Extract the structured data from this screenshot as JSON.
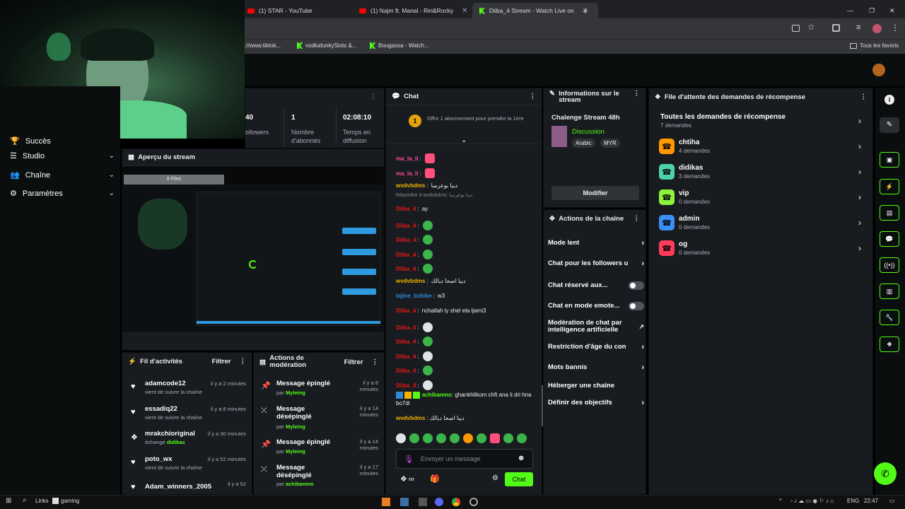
{
  "browser": {
    "tabs": [
      {
        "title": "(1) STAR - YouTube",
        "icon": "youtube-icon"
      },
      {
        "title": "(1) Najm ft. Manal - Riri&Rocky",
        "icon": "youtube-icon"
      },
      {
        "title": "Diiba_4 Stream - Watch Live on",
        "icon": "kick-icon"
      }
    ],
    "new_tab": "+",
    "window_controls": [
      "—",
      "❐",
      "✕"
    ],
    "bookmarks": [
      {
        "label": "://www.tiktok..."
      },
      {
        "label": "vodkafunkySlots &...",
        "icon": "kick-icon"
      },
      {
        "label": "Bougassa - Watch...",
        "icon": "kick-icon"
      }
    ],
    "all_bookmarks": "Tous les favoris"
  },
  "sidebar": {
    "items": [
      {
        "label": "Succès",
        "icon": "trophy-icon"
      },
      {
        "label": "Studio",
        "icon": "sliders-icon"
      },
      {
        "label": "Chaîne",
        "icon": "people-icon"
      },
      {
        "label": "Paramètres",
        "icon": "gear-icon"
      }
    ]
  },
  "stats": {
    "items": [
      {
        "value": "40",
        "label": "ollowers"
      },
      {
        "value": "1",
        "label": "Nombre d'abonnés"
      },
      {
        "value": "02:08:10",
        "label": "Temps en diffusion"
      }
    ]
  },
  "preview": {
    "title": "Aperçu du stream",
    "overlay_label": "9 Files"
  },
  "activity": {
    "title": "Fil d'activités",
    "filter": "Filtrer",
    "items": [
      {
        "user": "adamcode12",
        "time": "il y a 2 minutes",
        "detail": "vient de suivre la chaîne",
        "icon": "heart-icon"
      },
      {
        "user": "essadiq22",
        "time": "il y a 8 minutes",
        "detail": "vient de suivre la chaîne",
        "icon": "heart-icon"
      },
      {
        "user": "mrakchioriginal",
        "time": "il y a 30 minutes",
        "detail_prefix": "échangé",
        "detail_highlight": "didikas",
        "icon": "reward-icon"
      },
      {
        "user": "poto_wx",
        "time": "il y a 52 minutes",
        "detail": "vient de suivre la chaîne",
        "icon": "heart-icon"
      },
      {
        "user": "Adam_winners_2005",
        "time": "il y a 52",
        "detail": "",
        "icon": "heart-icon"
      }
    ]
  },
  "moderation": {
    "title": "Actions de modération",
    "filter": "Filtrer",
    "items": [
      {
        "action": "Message épinglé",
        "time": "il y a 8 minutes",
        "by": "par",
        "mod": "Myleing",
        "icon": "pin-icon"
      },
      {
        "action": "Message désépinglé",
        "time": "il y a 14 minutes",
        "by": "par",
        "mod": "Myleing",
        "icon": "unpin-icon"
      },
      {
        "action": "Message épinglé",
        "time": "il y a 14 minutes",
        "by": "par",
        "mod": "Myleing",
        "icon": "pin-icon"
      },
      {
        "action": "Message désépinglé",
        "time": "il y a 17 minutes",
        "by": "par",
        "mod": "achibanmo",
        "icon": "unpin-icon"
      }
    ]
  },
  "chat": {
    "title": "Chat",
    "sub_banner": {
      "count": "1",
      "text": "Offrir 1 abonnement pour prendre la 1ère"
    },
    "reply_to": "Répondre à wvdvbdms: ديبا بوعرسا",
    "messages": [
      {
        "user": "ma_la_li",
        "text": "",
        "color": "#ff4fa0",
        "emotes": 1,
        "emote_style": "heart"
      },
      {
        "user": "ma_la_li",
        "text": "",
        "color": "#ff4fa0",
        "emotes": 1,
        "emote_style": "heart"
      },
      {
        "user": "wvdvbdms",
        "text": "ديبا بوعرسا",
        "color": "#f0b400",
        "emotes": 0
      },
      {
        "user": "Diiba_4",
        "text": "ay",
        "color": "#e91916",
        "emotes": 0
      },
      {
        "user": "Diiba_4",
        "text": "",
        "color": "#e91916",
        "emotes": 1
      },
      {
        "user": "Diiba_4",
        "text": "",
        "color": "#e91916",
        "emotes": 1
      },
      {
        "user": "Diiba_4",
        "text": "",
        "color": "#e91916",
        "emotes": 1
      },
      {
        "user": "Diiba_4",
        "text": "",
        "color": "#e91916",
        "emotes": 1
      },
      {
        "user": "wvdvbdms",
        "text": "ديبا اصحا ديالك",
        "color": "#f0b400",
        "emotes": 0
      },
      {
        "user": "tajine_bzbibe",
        "text": "w3",
        "color": "#2e8ad8",
        "emotes": 0
      },
      {
        "user": "Diiba_4",
        "text": "nchallah ly shel ela ljami3",
        "color": "#e91916",
        "emotes": 0
      },
      {
        "user": "Diiba_4",
        "text": "",
        "color": "#e91916",
        "emotes": 1,
        "emote_style": "w"
      },
      {
        "user": "Diiba_4",
        "text": "",
        "color": "#e91916",
        "emotes": 1
      },
      {
        "user": "Diiba_4",
        "text": "",
        "color": "#e91916",
        "emotes": 1,
        "emote_style": "w"
      },
      {
        "user": "Diiba_4",
        "text": "",
        "color": "#e91916",
        "emotes": 1
      },
      {
        "user": "Diiba_4",
        "text": "",
        "color": "#e91916",
        "emotes": 1,
        "emote_style": "w"
      }
    ],
    "long_message": {
      "user": "achibanmo",
      "text": "ghankhlikom chft ana li dri hna bo7di",
      "color": "#53fc18"
    },
    "last_message": {
      "user": "wvdvbdms",
      "text": "ديبا اصحا ديالك",
      "color": "#f0b400"
    },
    "input_placeholder": "Envoyer un message",
    "infinity": "∞",
    "send_label": "Chat"
  },
  "stream_info": {
    "title": "Informations sur le stream",
    "stream_title": "Chalenge Stream 48h",
    "category": "Discussion",
    "tags": [
      "Arabic",
      "MYR"
    ],
    "edit_label": "Modifier"
  },
  "channel_actions": {
    "title": "Actions de la chaîne",
    "items": [
      {
        "label": "Mode lent",
        "control": "arrow"
      },
      {
        "label": "Chat pour les followers u",
        "control": "arrow"
      },
      {
        "label": "Chat réservé aux...",
        "control": "toggle"
      },
      {
        "label": "Chat en mode emote...",
        "control": "toggle"
      },
      {
        "label": "Modération de chat par intelligence artificielle",
        "control": "external"
      },
      {
        "label": "Restriction d'âge du con",
        "control": "arrow"
      },
      {
        "label": "Mots bannis",
        "control": "arrow"
      },
      {
        "label": "Héberger une chaîne",
        "control": "none"
      },
      {
        "label": "Définir des objectifs",
        "control": "arrow"
      }
    ]
  },
  "rewards": {
    "title": "File d'attente des demandes de récompense",
    "all": {
      "label": "Toutes les demandes de récompense",
      "count": "7 demandes"
    },
    "items": [
      {
        "name": "chtiha",
        "count": "4 demandes",
        "color": "#ff9800"
      },
      {
        "name": "didikas",
        "count": "3 demandes",
        "color": "#4cd1a9"
      },
      {
        "name": "vip",
        "count": "0 demandes",
        "color": "#8df33b"
      },
      {
        "name": "admin",
        "count": "0 demandes",
        "color": "#3b8ef3"
      },
      {
        "name": "og",
        "count": "0 demandes",
        "color": "#ff3b5c"
      }
    ]
  },
  "taskbar": {
    "search_label": "Links",
    "app_label": "gaming",
    "lang": "ENG",
    "time": "22:47"
  },
  "colors": {
    "accent": "#53fc18",
    "panel": "#181b1f",
    "background": "#0b0e0f"
  }
}
